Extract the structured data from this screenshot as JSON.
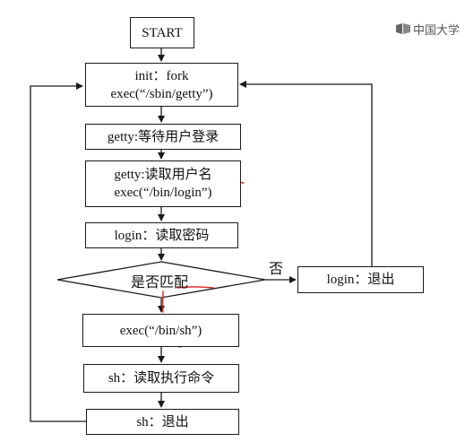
{
  "watermark": {
    "text": "中国大学"
  },
  "flowchart": {
    "start": "START",
    "init_line1": "init：fork",
    "init_line2": "exec(“/sbin/getty”)",
    "getty_wait": "getty:等待用户登录",
    "getty_read_line1": "getty:读取用户名",
    "getty_read_line2": "exec(“/bin/login”)",
    "login_read": "login：读取密码",
    "decision": "是否匹配",
    "no_label": "否",
    "login_exit": "login：退出",
    "exec_sh": "exec(“/bin/sh”)",
    "sh_read": "sh：读取执行命令",
    "sh_exit": "sh：退出"
  },
  "colors": {
    "line": "#1a1a1a",
    "annotation": "#e0231c"
  }
}
